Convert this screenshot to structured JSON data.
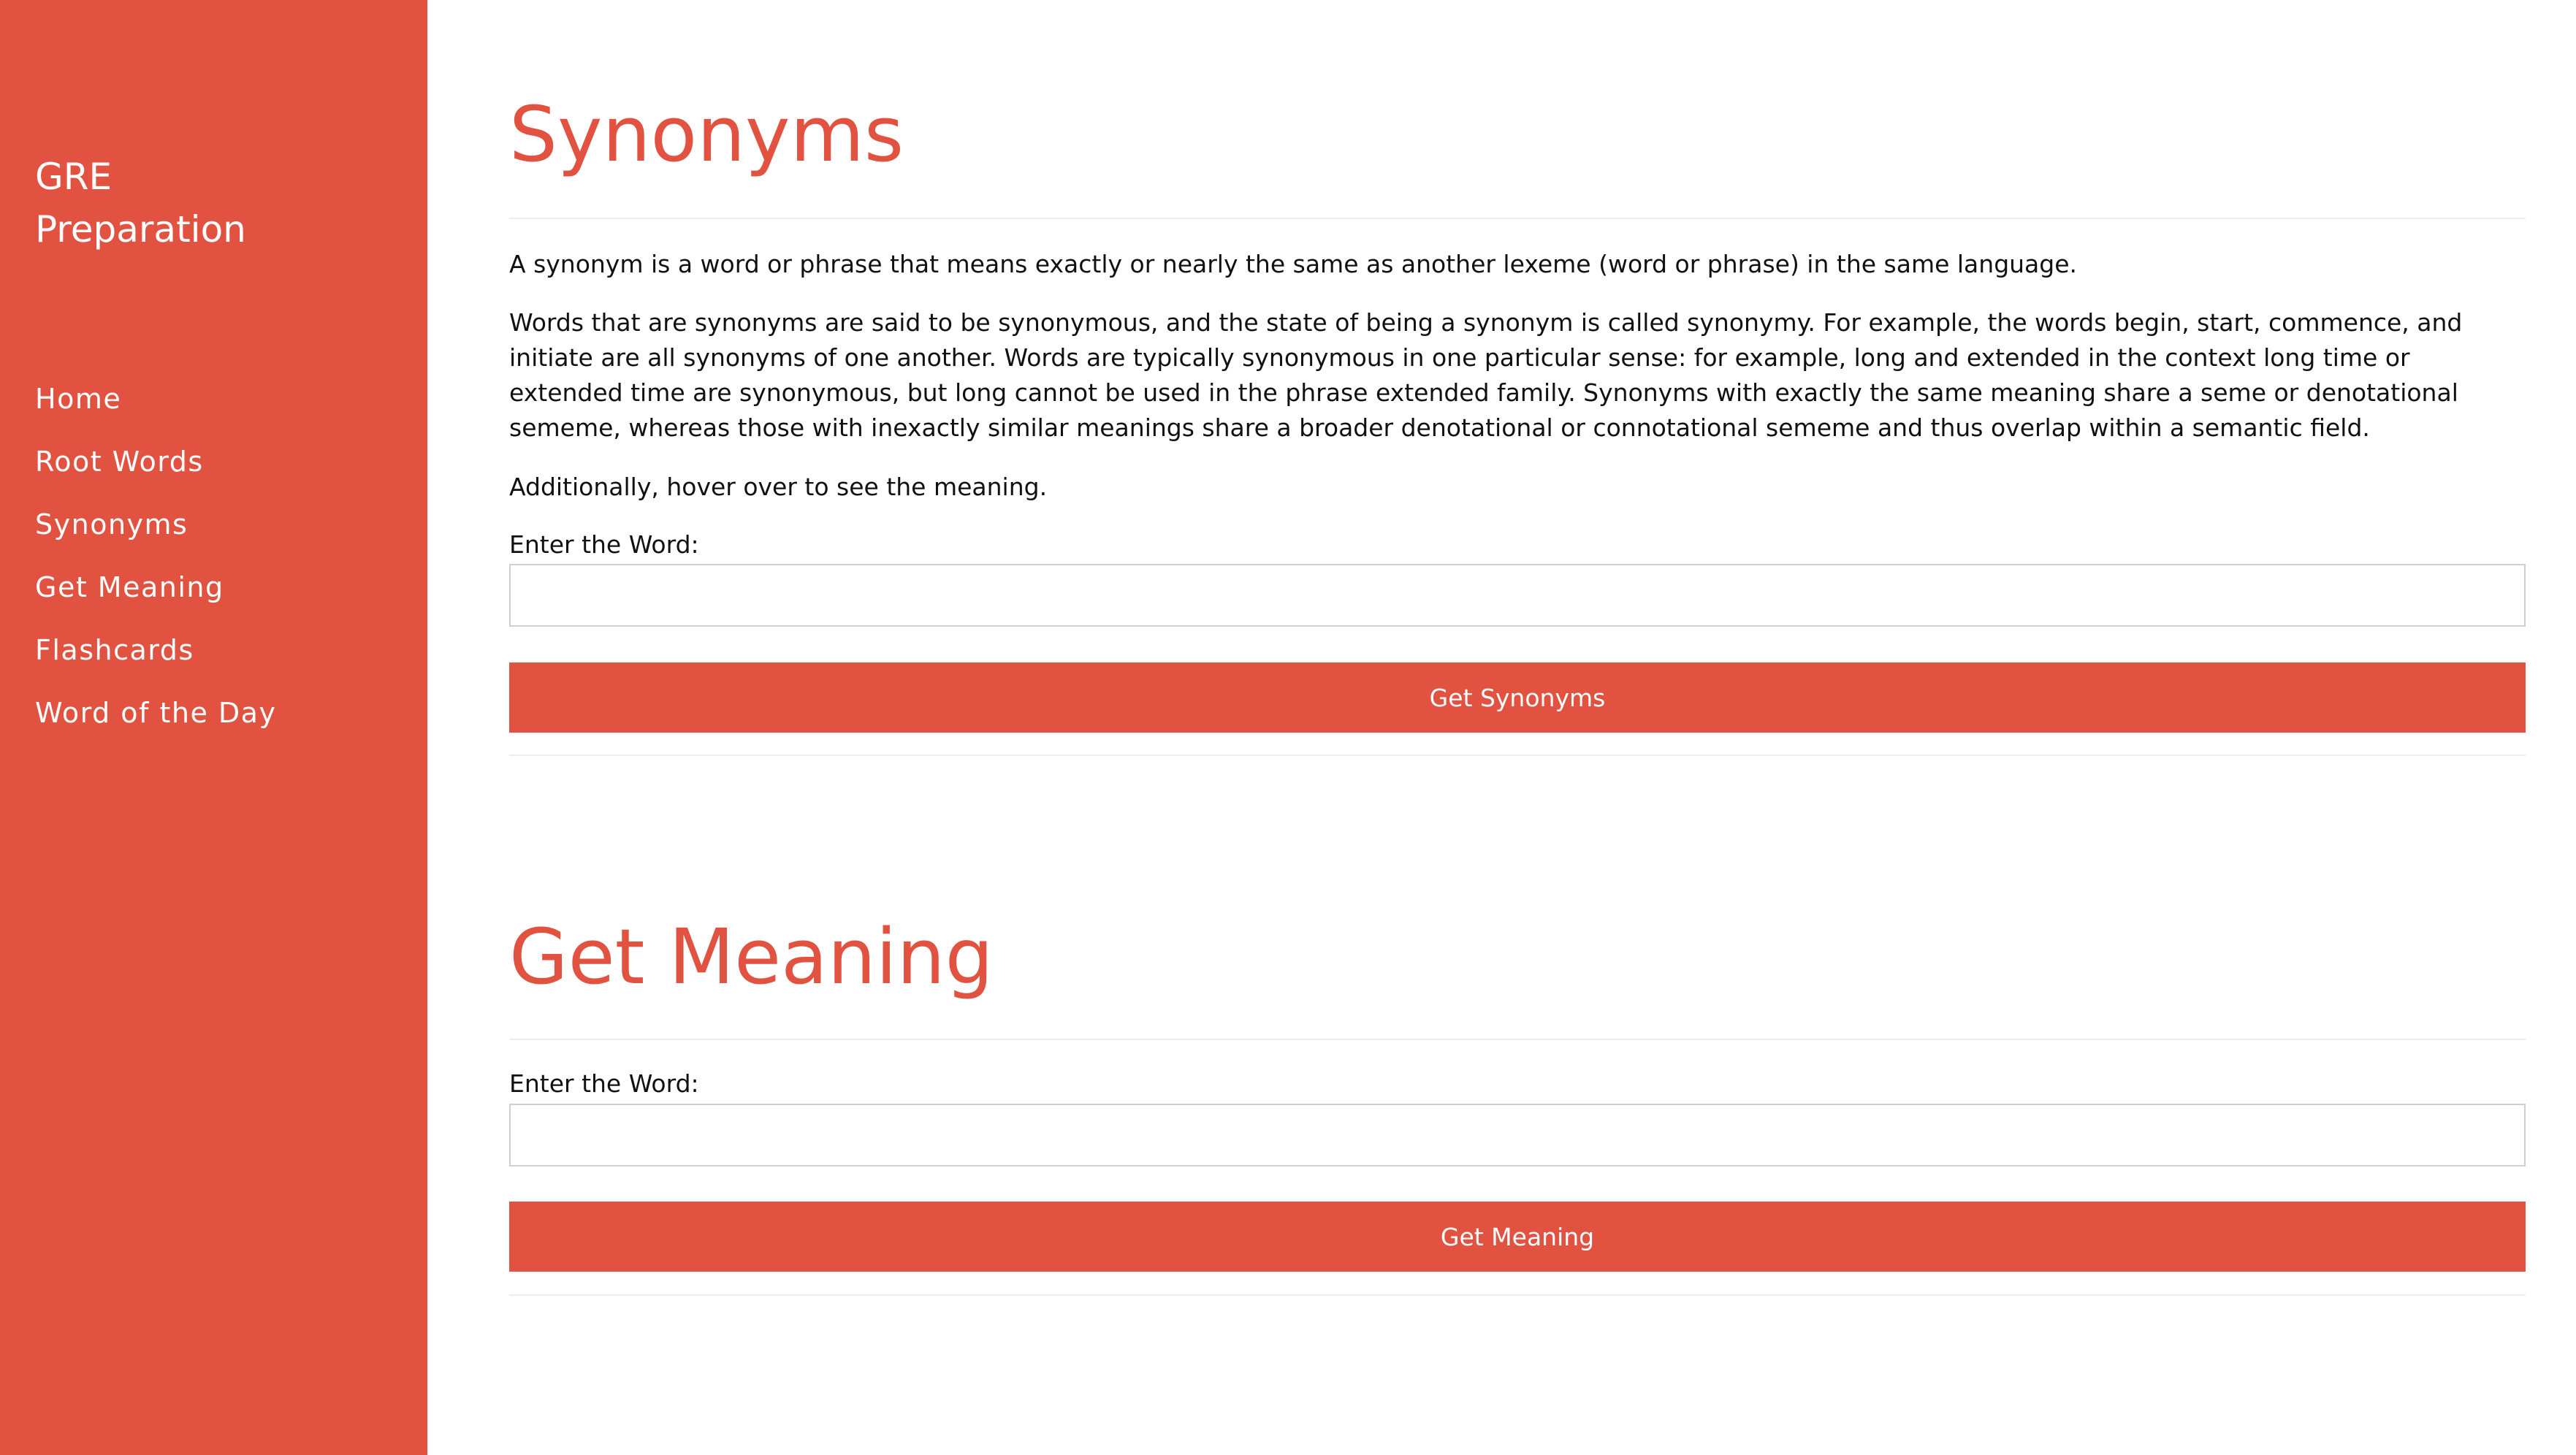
{
  "colors": {
    "accent": "#e15241",
    "text": "#111111",
    "background": "#ffffff"
  },
  "sidebar": {
    "brand": "GRE\nPreparation",
    "items": [
      {
        "label": "Home"
      },
      {
        "label": "Root Words"
      },
      {
        "label": "Synonyms"
      },
      {
        "label": "Get Meaning"
      },
      {
        "label": "Flashcards"
      },
      {
        "label": "Word of the Day"
      }
    ]
  },
  "synonyms": {
    "title": "Synonyms",
    "paragraphs": [
      "A synonym is a word or phrase that means exactly or nearly the same as another lexeme (word or phrase) in the same language.",
      "Words that are synonyms are said to be synonymous, and the state of being a synonym is called synonymy. For example, the words begin, start, commence, and initiate are all synonyms of one another. Words are typically synonymous in one particular sense: for example, long and extended in the context long time or extended time are synonymous, but long cannot be used in the phrase extended family. Synonyms with exactly the same meaning share a seme or denotational sememe, whereas those with inexactly similar meanings share a broader denotational or connotational sememe and thus overlap within a semantic field.",
      "Additionally, hover over to see the meaning."
    ],
    "input_label": "Enter the Word:",
    "input_value": "",
    "button_label": "Get Synonyms"
  },
  "meaning": {
    "title": "Get Meaning",
    "input_label": "Enter the Word:",
    "input_value": "",
    "button_label": "Get Meaning"
  }
}
